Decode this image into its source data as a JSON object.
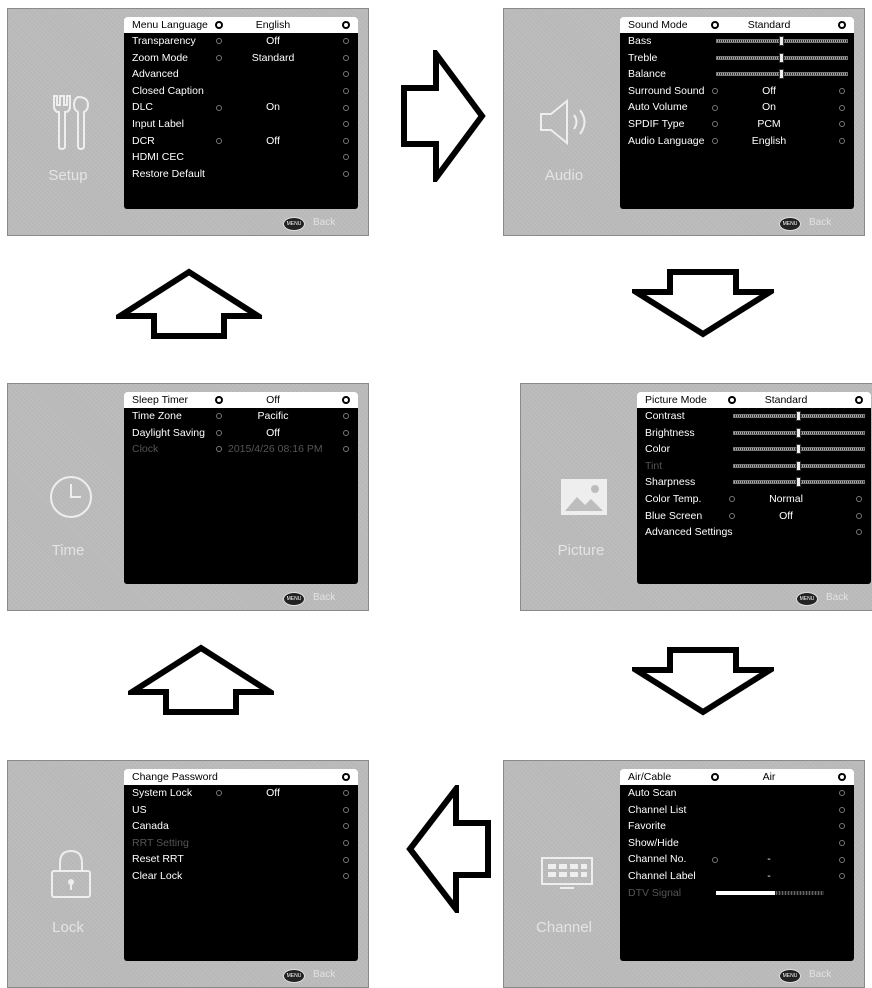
{
  "footer": {
    "menu_badge": "MENU",
    "back_label": "Back"
  },
  "setup": {
    "label": "Setup",
    "rows": [
      {
        "label": "Menu Language",
        "value": "English",
        "dot1": true,
        "dot2": true,
        "selected": true
      },
      {
        "label": "Transparency",
        "value": "Off",
        "dot1": true,
        "dot2": true
      },
      {
        "label": "Zoom Mode",
        "value": "Standard",
        "dot1": true,
        "dot2": true
      },
      {
        "label": "Advanced",
        "value": "",
        "dot1": false,
        "dot2": true
      },
      {
        "label": "Closed Caption",
        "value": "",
        "dot1": false,
        "dot2": true
      },
      {
        "label": "DLC",
        "value": "On",
        "dot1": true,
        "dot2": true
      },
      {
        "label": "Input Label",
        "value": "",
        "dot1": false,
        "dot2": true
      },
      {
        "label": "DCR",
        "value": "Off",
        "dot1": true,
        "dot2": true
      },
      {
        "label": "HDMI CEC",
        "value": "",
        "dot1": false,
        "dot2": true
      },
      {
        "label": "Restore Default",
        "value": "",
        "dot1": false,
        "dot2": true
      }
    ]
  },
  "audio": {
    "label": "Audio",
    "rows": [
      {
        "label": "Sound Mode",
        "value": "Standard",
        "dot1": true,
        "dot2": true,
        "selected": true
      },
      {
        "label": "Bass",
        "slider": 0.5
      },
      {
        "label": "Treble",
        "slider": 0.5
      },
      {
        "label": "Balance",
        "slider": 0.5
      },
      {
        "label": "Surround Sound",
        "value": "Off",
        "dot1": true,
        "dot2": true
      },
      {
        "label": "Auto Volume",
        "value": "On",
        "dot1": true,
        "dot2": true
      },
      {
        "label": "SPDIF Type",
        "value": "PCM",
        "dot1": true,
        "dot2": true
      },
      {
        "label": "Audio Language",
        "value": "English",
        "dot1": true,
        "dot2": true
      }
    ]
  },
  "time": {
    "label": "Time",
    "rows": [
      {
        "label": "Sleep Timer",
        "value": "Off",
        "dot1": true,
        "dot2": true,
        "selected": true
      },
      {
        "label": "Time Zone",
        "value": "Pacific",
        "dot1": true,
        "dot2": true
      },
      {
        "label": "Daylight Saving",
        "value": "Off",
        "dot1": true,
        "dot2": true
      },
      {
        "label": "Clock",
        "value": "2015/4/26  08:16 PM",
        "dot1": true,
        "dot2": true,
        "dim": true
      }
    ]
  },
  "picture": {
    "label": "Picture",
    "rows": [
      {
        "label": "Picture Mode",
        "value": "Standard",
        "dot1": true,
        "dot2": true,
        "selected": true
      },
      {
        "label": "Contrast",
        "slider": 0.5
      },
      {
        "label": "Brightness",
        "slider": 0.5
      },
      {
        "label": "Color",
        "slider": 0.5
      },
      {
        "label": "Tint",
        "slider": 0.5,
        "dim": true
      },
      {
        "label": "Sharpness",
        "slider": 0.5
      },
      {
        "label": "Color Temp.",
        "value": "Normal",
        "dot1": true,
        "dot2": true
      },
      {
        "label": "Blue Screen",
        "value": "Off",
        "dot1": true,
        "dot2": true
      },
      {
        "label": "Advanced Settings",
        "value": "",
        "dot1": false,
        "dot2": true
      }
    ]
  },
  "lock": {
    "label": "Lock",
    "rows": [
      {
        "label": "Change Password",
        "value": "",
        "dot1": false,
        "dot2": true,
        "selected": true
      },
      {
        "label": "System Lock",
        "value": "Off",
        "dot1": true,
        "dot2": true
      },
      {
        "label": "US",
        "value": "",
        "dot1": false,
        "dot2": true
      },
      {
        "label": "Canada",
        "value": "",
        "dot1": false,
        "dot2": true
      },
      {
        "label": "RRT Setting",
        "value": "",
        "dot1": false,
        "dot2": true,
        "dim": true
      },
      {
        "label": "Reset RRT",
        "value": "",
        "dot1": false,
        "dot2": true
      },
      {
        "label": "Clear Lock",
        "value": "",
        "dot1": false,
        "dot2": true
      }
    ]
  },
  "channel": {
    "label": "Channel",
    "rows": [
      {
        "label": "Air/Cable",
        "value": "Air",
        "dot1": true,
        "dot2": true,
        "selected": true
      },
      {
        "label": "Auto Scan",
        "value": "",
        "dot1": false,
        "dot2": true
      },
      {
        "label": "Channel List",
        "value": "",
        "dot1": false,
        "dot2": true
      },
      {
        "label": "Favorite",
        "value": "",
        "dot1": false,
        "dot2": true
      },
      {
        "label": "Show/Hide",
        "value": "",
        "dot1": false,
        "dot2": true
      },
      {
        "label": "Channel No.",
        "value": "-",
        "dot1": true,
        "dot2": true
      },
      {
        "label": "Channel Label",
        "value": "-",
        "dot1": false,
        "dot2": true
      },
      {
        "label": "DTV Signal",
        "signal": 0.55,
        "dim": true
      }
    ]
  }
}
